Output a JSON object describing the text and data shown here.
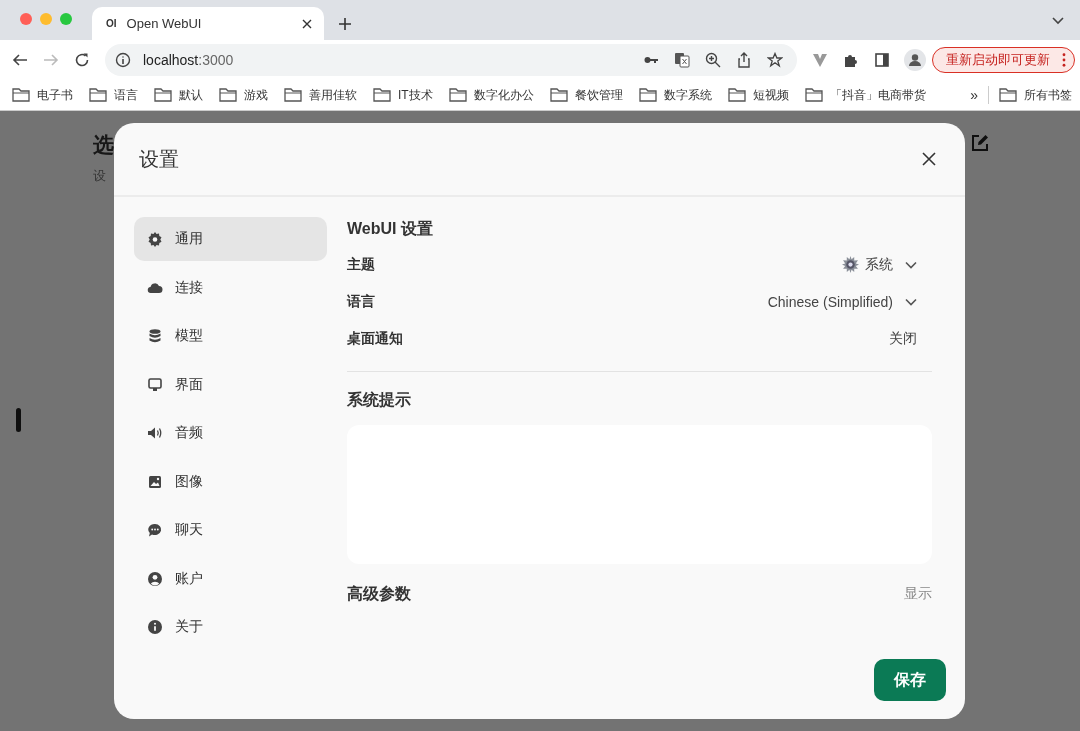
{
  "browser": {
    "tabs": [
      {
        "title": "Open WebUI",
        "favicon": "OI",
        "selected": true
      }
    ],
    "address": {
      "host": "localhost",
      "port": ":3000"
    },
    "update_button": "重新启动即可更新",
    "bookmarks": [
      "电子书",
      "语言",
      "默认",
      "游戏",
      "善用佳软",
      "IT技术",
      "数字化办公",
      "餐饮管理",
      "数字系统",
      "短视频",
      "「抖音」电商带货"
    ],
    "bookmarks_overflow": "»",
    "all_bookmarks": "所有书签"
  },
  "page": {
    "heading": "选",
    "subheading": "设"
  },
  "dialog": {
    "title": "设置",
    "nav": [
      {
        "label": "通用",
        "kind": "gear",
        "selected": true
      },
      {
        "label": "连接",
        "kind": "cloud",
        "selected": false
      },
      {
        "label": "模型",
        "kind": "database",
        "selected": false
      },
      {
        "label": "界面",
        "kind": "monitor",
        "selected": false
      },
      {
        "label": "音频",
        "kind": "speaker",
        "selected": false
      },
      {
        "label": "图像",
        "kind": "image",
        "selected": false
      },
      {
        "label": "聊天",
        "kind": "chat",
        "selected": false
      },
      {
        "label": "账户",
        "kind": "user",
        "selected": false
      },
      {
        "label": "关于",
        "kind": "info",
        "selected": false
      }
    ],
    "section_title": "WebUI 设置",
    "settings": [
      {
        "label": "主题",
        "value": "系统",
        "kind": "theme"
      },
      {
        "label": "语言",
        "value": "Chinese (Simplified)",
        "kind": "select"
      },
      {
        "label": "桌面通知",
        "value": "关闭",
        "kind": "toggle"
      }
    ],
    "system_prompt": {
      "title": "系统提示"
    },
    "advanced": {
      "label": "高级参数",
      "action": "显示"
    },
    "save": "保存"
  }
}
